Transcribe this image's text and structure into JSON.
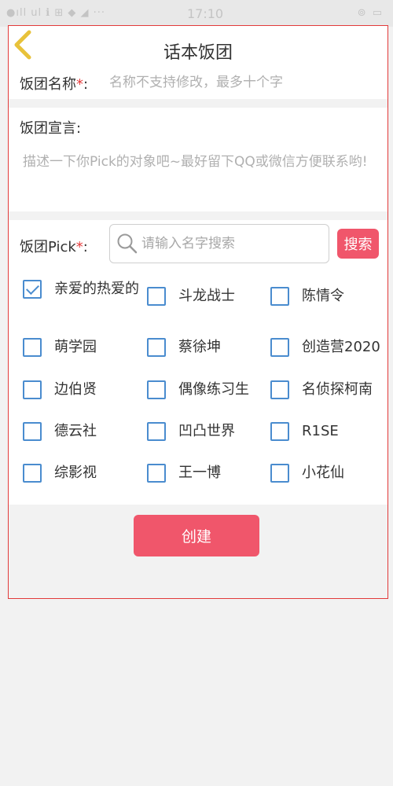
{
  "status_bar": {
    "time": "17:10",
    "left": "●ıll ul ℹ ⊞ ◆ ◢ ···",
    "right": "⊚ ▭"
  },
  "header": {
    "title": "话本饭团",
    "back_icon": "chevron-left-icon",
    "accent_color": "#e8c23a"
  },
  "form": {
    "name": {
      "label": "饭团名称",
      "required_mark": "*",
      "colon": ":",
      "placeholder": "名称不支持修改，最多十个字"
    },
    "declaration": {
      "label": "饭团宣言:",
      "placeholder": "描述一下你Pick的对象吧~最好留下QQ或微信方便联系哟!"
    },
    "pick": {
      "label": "饭团Pick",
      "required_mark": "*",
      "colon": ":",
      "search_placeholder": "请输入名字搜索",
      "search_button": "搜索",
      "options": [
        {
          "label": "亲爱的热爱的",
          "checked": true
        },
        {
          "label": "斗龙战士",
          "checked": false
        },
        {
          "label": "陈情令",
          "checked": false
        },
        {
          "label": "萌学园",
          "checked": false
        },
        {
          "label": "蔡徐坤",
          "checked": false
        },
        {
          "label": "创造营2020",
          "checked": false
        },
        {
          "label": "边伯贤",
          "checked": false
        },
        {
          "label": "偶像练习生",
          "checked": false
        },
        {
          "label": "名侦探柯南",
          "checked": false
        },
        {
          "label": "德云社",
          "checked": false
        },
        {
          "label": "凹凸世界",
          "checked": false
        },
        {
          "label": "R1SE",
          "checked": false
        },
        {
          "label": "综影视",
          "checked": false
        },
        {
          "label": "王一博",
          "checked": false
        },
        {
          "label": "小花仙",
          "checked": false
        }
      ]
    }
  },
  "create_button": "创建",
  "colors": {
    "primary": "#f0566b",
    "checkbox": "#4a8ccf",
    "required": "#e63c3c",
    "frame_border": "#e23a3a"
  }
}
